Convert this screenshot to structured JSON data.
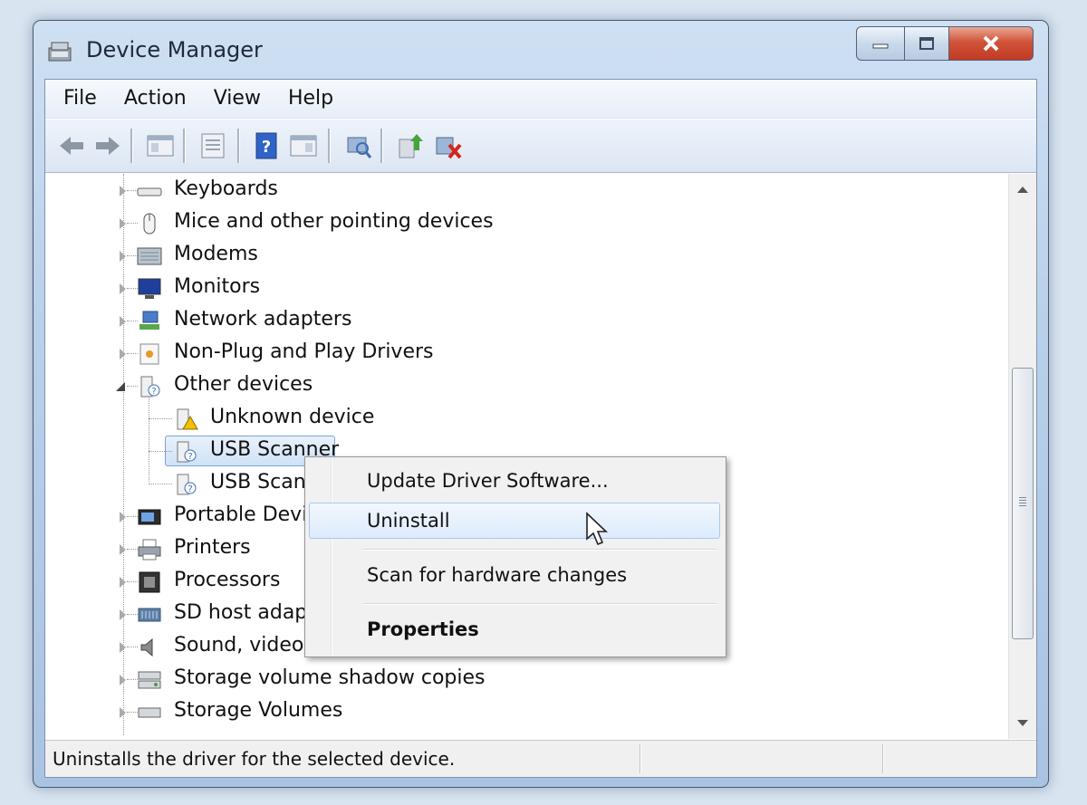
{
  "window": {
    "title": "Device Manager"
  },
  "menubar": {
    "items": [
      "File",
      "Action",
      "View",
      "Help"
    ]
  },
  "toolbar": {
    "icons": [
      "back-arrow-icon",
      "forward-arrow-icon",
      "show-hide-console-tree-icon",
      "properties-icon",
      "help-icon",
      "action-pane-icon",
      "scan-hardware-icon",
      "update-driver-icon",
      "uninstall-icon"
    ]
  },
  "tree": {
    "items": [
      {
        "label": "Keyboards",
        "icon": "keyboard-icon"
      },
      {
        "label": "Mice and other pointing devices",
        "icon": "mouse-icon"
      },
      {
        "label": "Modems",
        "icon": "modem-icon"
      },
      {
        "label": "Monitors",
        "icon": "monitor-icon"
      },
      {
        "label": "Network adapters",
        "icon": "network-adapter-icon"
      },
      {
        "label": "Non-Plug and Play Drivers",
        "icon": "driver-icon"
      },
      {
        "label": "Other devices",
        "icon": "unknown-device-icon"
      },
      {
        "label": "Unknown device",
        "icon": "warning-device-icon"
      },
      {
        "label": "USB Scanner",
        "icon": "unknown-device-icon"
      },
      {
        "label": "USB Scanner",
        "icon": "unknown-device-icon"
      },
      {
        "label": "Portable Devices",
        "icon": "portable-device-icon"
      },
      {
        "label": "Printers",
        "icon": "printer-icon"
      },
      {
        "label": "Processors",
        "icon": "processor-icon"
      },
      {
        "label": "SD host adapters",
        "icon": "sd-adapter-icon"
      },
      {
        "label": "Sound, video and game controllers",
        "icon": "speaker-icon"
      },
      {
        "label": "Storage volume shadow copies",
        "icon": "storage-icon"
      },
      {
        "label": "Storage Volumes",
        "icon": "storage-icon"
      }
    ]
  },
  "context_menu": {
    "items": [
      "Update Driver Software...",
      "Uninstall",
      "Scan for hardware changes",
      "Properties"
    ]
  },
  "statusbar": {
    "text": "Uninstalls the driver for the selected device."
  }
}
